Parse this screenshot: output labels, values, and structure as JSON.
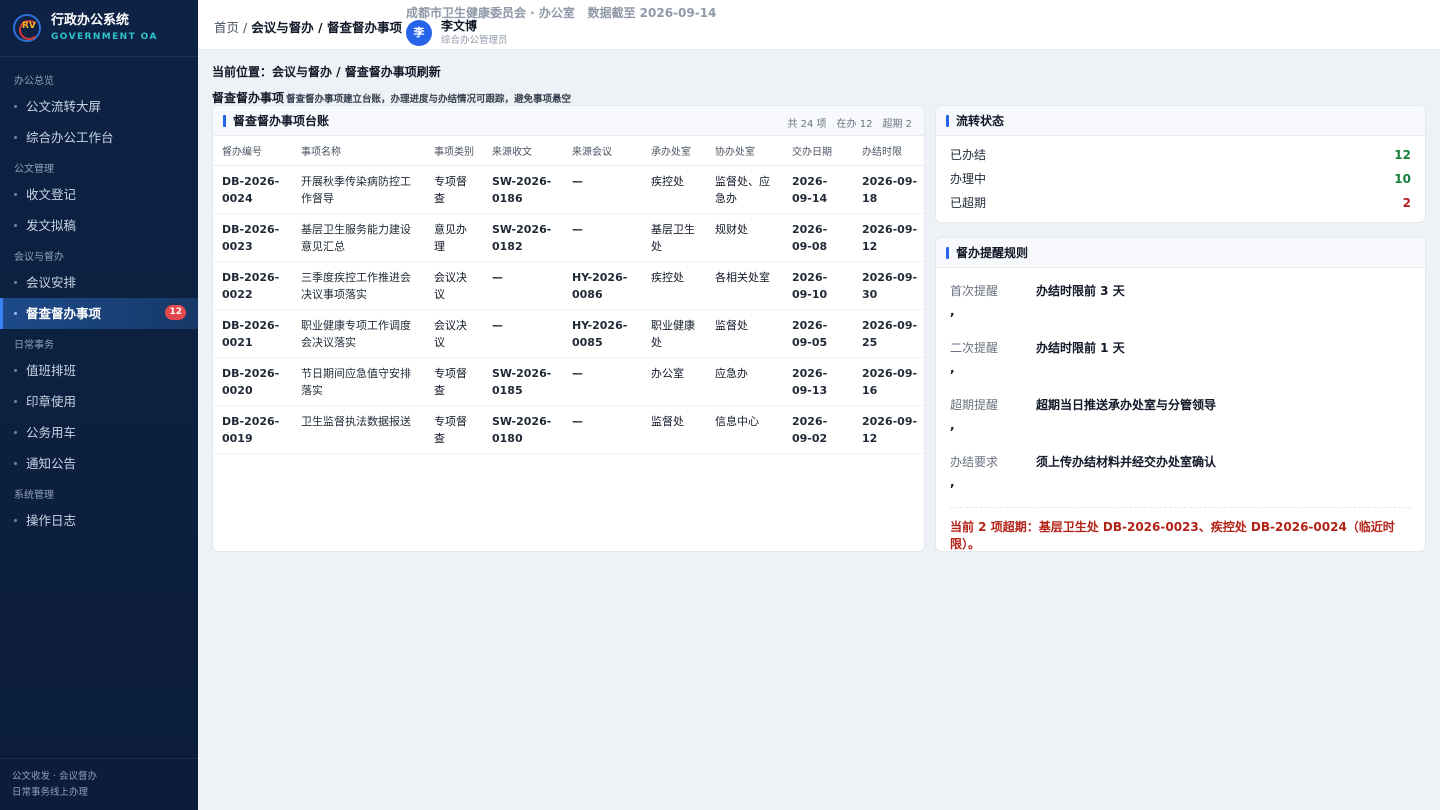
{
  "app": {
    "title": "行政办公系统",
    "subtitle": "GOVERNMENT OA",
    "logo_text": "RV"
  },
  "sidebar": {
    "groups": [
      {
        "label": "办公总览",
        "items": [
          {
            "label": "公文流转大屏"
          },
          {
            "label": "综合办公工作台"
          }
        ]
      },
      {
        "label": "公文管理",
        "items": [
          {
            "label": "收文登记"
          },
          {
            "label": "发文拟稿"
          }
        ]
      },
      {
        "label": "会议与督办",
        "items": [
          {
            "label": "会议安排"
          },
          {
            "label": "督查督办事项",
            "badge": "12"
          }
        ]
      },
      {
        "label": "日常事务",
        "items": [
          {
            "label": "值班排班"
          },
          {
            "label": "印章使用"
          },
          {
            "label": "公务用车"
          },
          {
            "label": "通知公告"
          }
        ]
      },
      {
        "label": "系统管理",
        "items": [
          {
            "label": "操作日志"
          }
        ]
      }
    ],
    "footer_line1": "公文收发 · 会议督办",
    "footer_line2": "日常事务线上办理"
  },
  "header": {
    "crumb_home": "首页",
    "crumb_sep": " / ",
    "crumb_parent": "会议与督办",
    "crumb_current": "督查督办事项",
    "org": "成都市卫生健康委员会 · 办公室",
    "data_date": "数据截至 2026-09-14",
    "user_initial": "李",
    "user_name": "李文博",
    "user_role": "综合办公管理员"
  },
  "main": {
    "location": "当前位置：会议与督办 / 督查督办事项刷新",
    "module_title": "督查督办事项",
    "module_desc": "督查督办事项建立台账，办理进度与办结情况可跟踪，避免事项悬空"
  },
  "ledger": {
    "title": "督查督办事项台账",
    "total": "共 24 项",
    "in_progress": "在办 12",
    "overdue": "超期 2",
    "columns": [
      "督办编号",
      "事项名称",
      "事项类别",
      "来源收文",
      "来源会议",
      "承办处室",
      "协办处室",
      "交办日期",
      "办结时限"
    ],
    "rows": [
      [
        "DB-2026-0024",
        "开展秋季传染病防控工作督导",
        "专项督查",
        "SW-2026-0186",
        "—",
        "疾控处",
        "监督处、应急办",
        "2026-09-14",
        "2026-09-18"
      ],
      [
        "DB-2026-0023",
        "基层卫生服务能力建设意见汇总",
        "意见办理",
        "SW-2026-0182",
        "—",
        "基层卫生处",
        "规财处",
        "2026-09-08",
        "2026-09-12"
      ],
      [
        "DB-2026-0022",
        "三季度疾控工作推进会决议事项落实",
        "会议决议",
        "—",
        "HY-2026-0086",
        "疾控处",
        "各相关处室",
        "2026-09-10",
        "2026-09-30"
      ],
      [
        "DB-2026-0021",
        "职业健康专项工作调度会决议落实",
        "会议决议",
        "—",
        "HY-2026-0085",
        "职业健康处",
        "监督处",
        "2026-09-05",
        "2026-09-25"
      ],
      [
        "DB-2026-0020",
        "节日期间应急值守安排落实",
        "专项督查",
        "SW-2026-0185",
        "—",
        "办公室",
        "应急办",
        "2026-09-13",
        "2026-09-16"
      ],
      [
        "DB-2026-0019",
        "卫生监督执法数据报送",
        "专项督查",
        "SW-2026-0180",
        "—",
        "监督处",
        "信息中心",
        "2026-09-02",
        "2026-09-12"
      ]
    ]
  },
  "status": {
    "title": "流转状态",
    "items": [
      {
        "label": "已办结",
        "value": "12",
        "color": "#15803d"
      },
      {
        "label": "办理中",
        "value": "10",
        "color": "#15803d"
      },
      {
        "label": "已超期",
        "value": "2",
        "color": "#b91c1c"
      }
    ]
  },
  "rules": {
    "title": "督办提醒规则",
    "items": [
      {
        "key": "首次提醒",
        "desc": "办结时限前 3 天",
        "comma": ","
      },
      {
        "key": "二次提醒",
        "desc": "办结时限前 1 天",
        "comma": ","
      },
      {
        "key": "超期提醒",
        "desc": "超期当日推送承办处室与分管领导",
        "comma": ","
      },
      {
        "key": "办结要求",
        "desc": "须上传办结材料并经交办处室确认",
        "comma": ","
      }
    ],
    "alert": "当前 2 项超期：基层卫生处 DB-2026-0023、疾控处 DB-2026-0024（临近时限）。"
  }
}
